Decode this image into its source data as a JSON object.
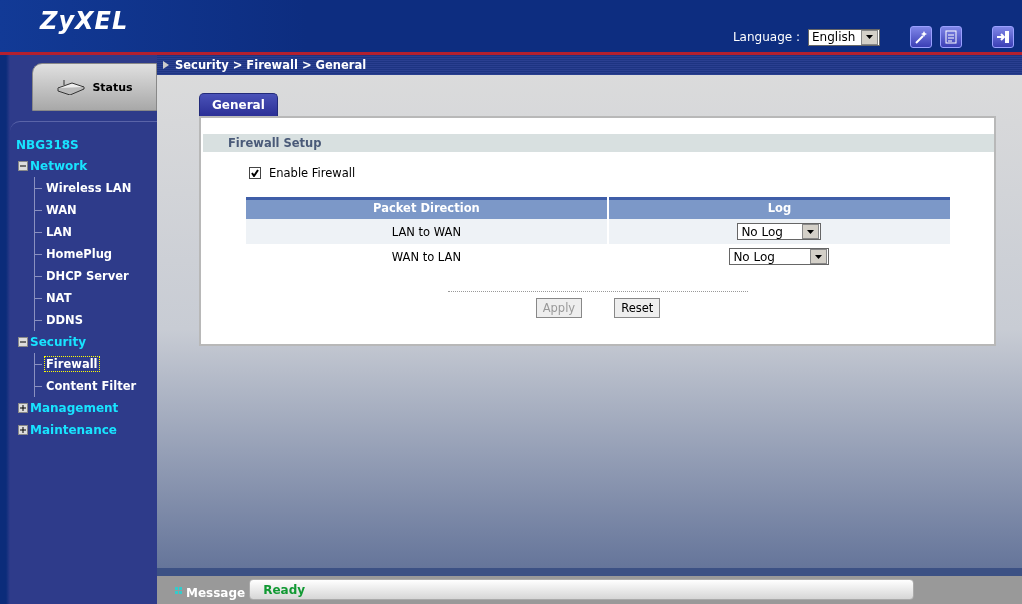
{
  "header": {
    "logo": "ZyXEL",
    "language_label": "Language :",
    "language": "English"
  },
  "breadcrumb": "Security > Firewall > General",
  "sidebar": {
    "status_tab": "Status",
    "device": "NBG318S",
    "tree": [
      {
        "label": "Network",
        "expanded": true,
        "children": [
          {
            "label": "Wireless LAN",
            "selected": false
          },
          {
            "label": "WAN",
            "selected": false
          },
          {
            "label": "LAN",
            "selected": false
          },
          {
            "label": "HomePlug",
            "selected": false
          },
          {
            "label": "DHCP Server",
            "selected": false
          },
          {
            "label": "NAT",
            "selected": false
          },
          {
            "label": "DDNS",
            "selected": false
          }
        ]
      },
      {
        "label": "Security",
        "expanded": true,
        "children": [
          {
            "label": "Firewall",
            "selected": true
          },
          {
            "label": "Content Filter",
            "selected": false
          }
        ]
      },
      {
        "label": "Management",
        "expanded": false
      },
      {
        "label": "Maintenance",
        "expanded": false
      }
    ]
  },
  "tabs": [
    {
      "label": "General",
      "selected": true
    }
  ],
  "section_title": "Firewall Setup",
  "enable_firewall": {
    "label": "Enable Firewall",
    "checked": true
  },
  "table": {
    "columns": [
      "Packet Direction",
      "Log"
    ],
    "rows": [
      {
        "direction": "LAN to WAN",
        "log": "No Log"
      },
      {
        "direction": "WAN to LAN",
        "log": "No Log"
      }
    ]
  },
  "buttons": [
    {
      "label": "Apply",
      "disabled": true
    },
    {
      "label": "Reset",
      "disabled": false
    }
  ],
  "status_bar": {
    "label": "Message",
    "value": "Ready"
  }
}
